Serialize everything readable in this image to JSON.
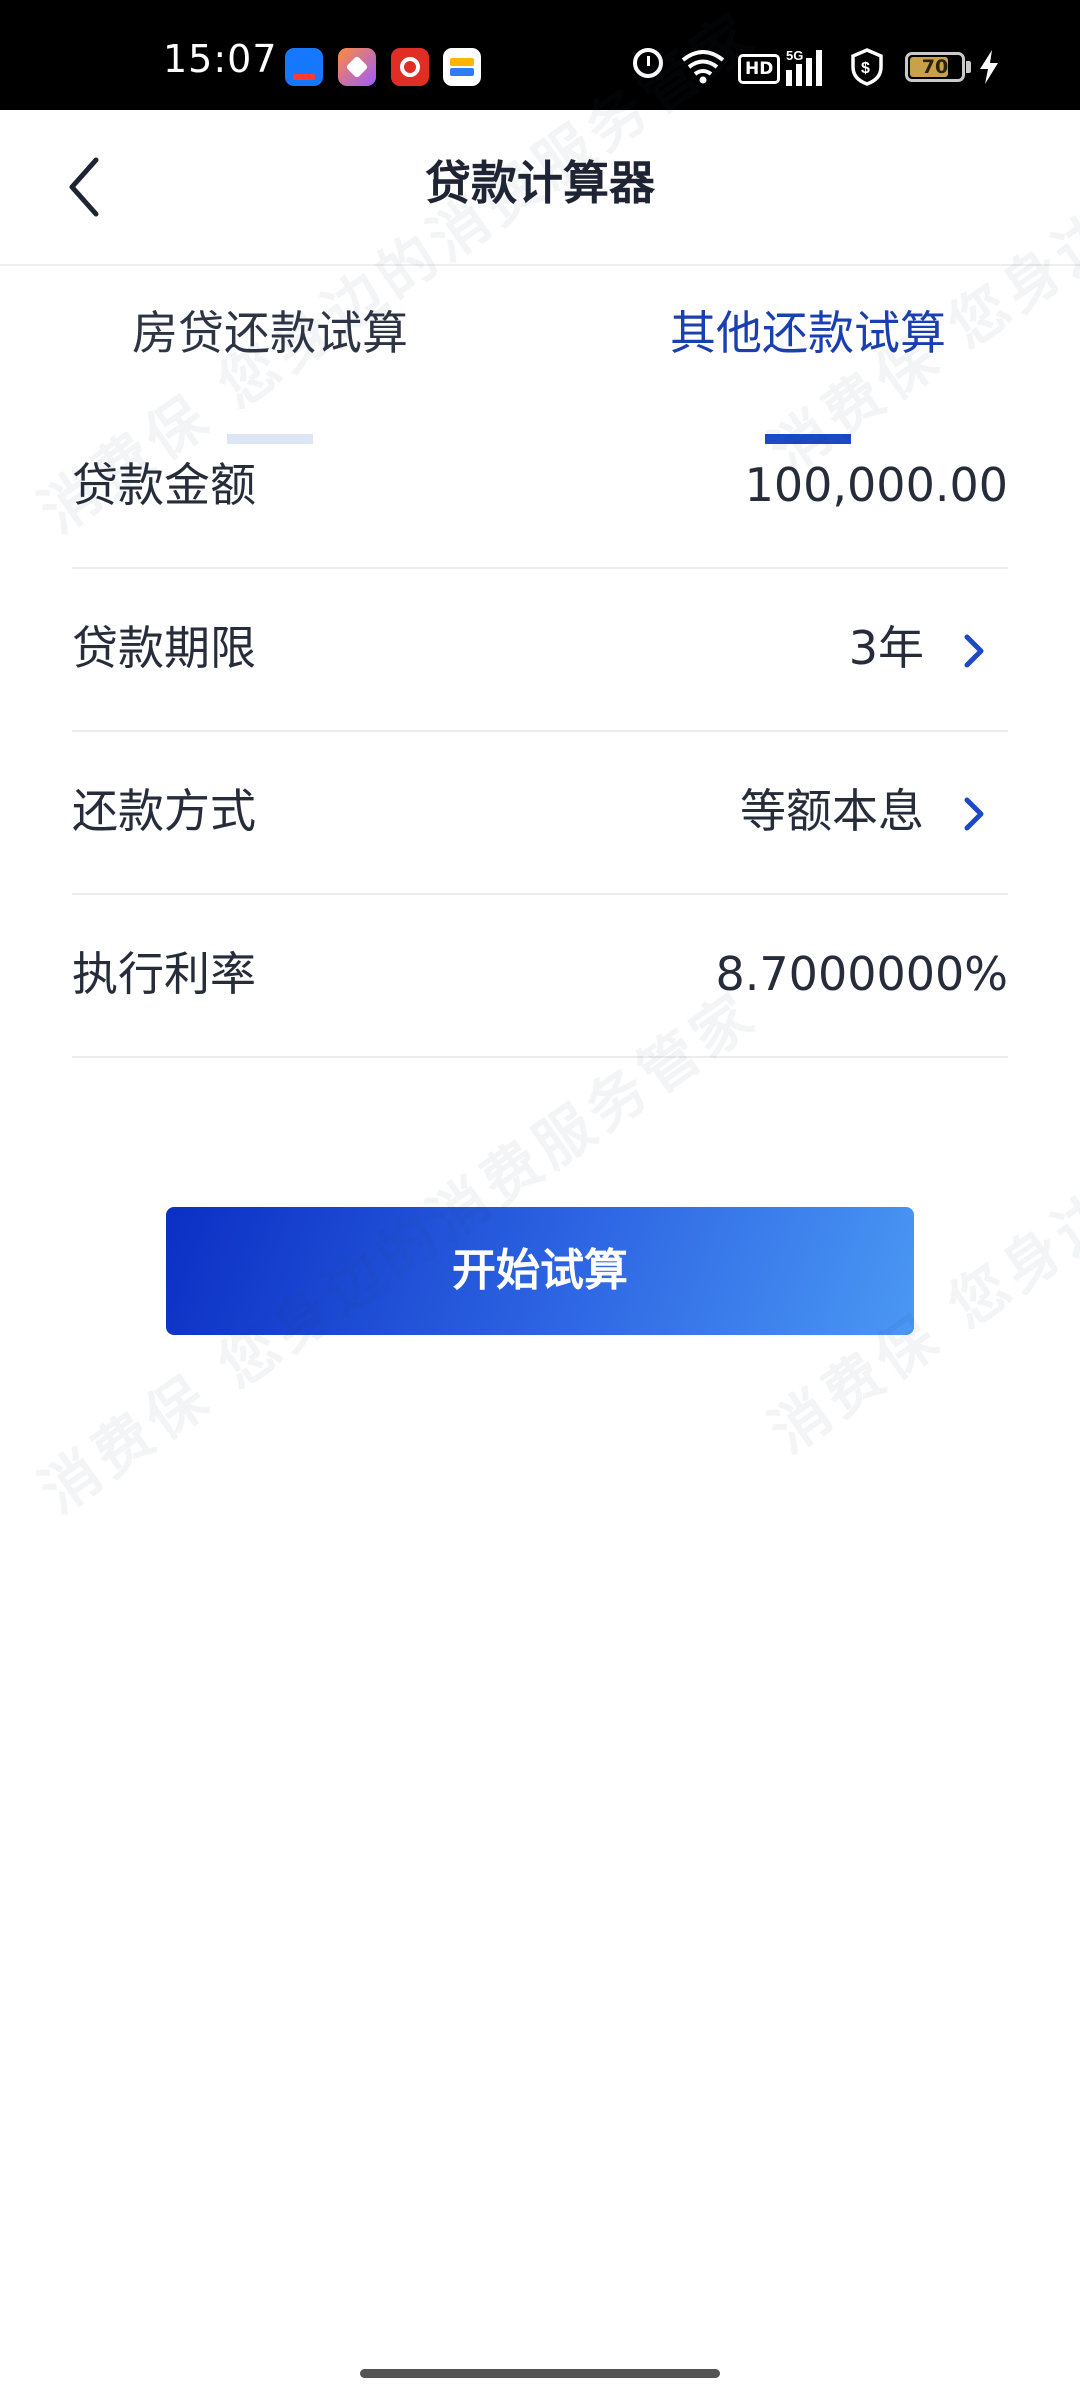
{
  "status_bar": {
    "time": "15:07",
    "battery": "70",
    "network": "5G",
    "hd": "HD",
    "apps": [
      "alipay-icon",
      "shortcut-app-icon",
      "pinduoduo-icon",
      "wallet-icon"
    ],
    "system_icons": [
      "alarm-icon",
      "wifi-icon",
      "hd-icon",
      "signal-icon",
      "shield-icon",
      "battery-icon",
      "charging-icon"
    ]
  },
  "nav": {
    "title": "贷款计算器",
    "back_icon": "chevron-left-icon"
  },
  "tabs": [
    {
      "label": "房贷还款试算",
      "active": false
    },
    {
      "label": "其他还款试算",
      "active": true
    }
  ],
  "form": {
    "rows": [
      {
        "label": "贷款金额",
        "value": "100,000.00",
        "has_arrow": false
      },
      {
        "label": "贷款期限",
        "value": "3年",
        "has_arrow": true
      },
      {
        "label": "还款方式",
        "value": "等额本息",
        "has_arrow": true
      },
      {
        "label": "执行利率",
        "value": "8.7000000%",
        "has_arrow": false
      }
    ]
  },
  "actions": {
    "calculate_label": "开始试算"
  },
  "watermark": {
    "line_a": "消费保 您身边的消费服务管家",
    "line_b": "消费保 您身边的消费服务管家"
  },
  "colors": {
    "accent": "#1d48c7",
    "button_start": "#0b2fc4",
    "button_end": "#4a98f4",
    "text_primary": "#262c3a",
    "status_bar_bg": "#000000"
  }
}
